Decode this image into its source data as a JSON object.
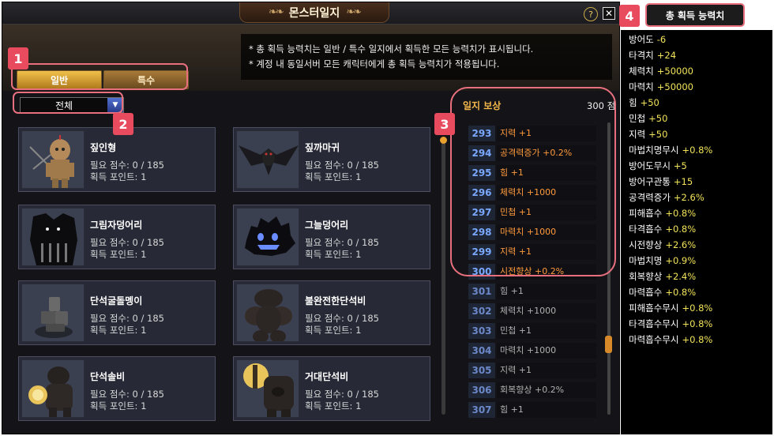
{
  "window": {
    "title": "몬스터일지",
    "help_label": "?",
    "close_label": "✕"
  },
  "notice": {
    "line1": "* 총 획득 능력치는 일반 / 특수 일지에서 획득한 모든 능력치가 표시됩니다.",
    "line2": "* 계정 내 동일서버 모든 캐릭터에게 총 획득 능력치가 적용됩니다."
  },
  "tabs": [
    {
      "label": "일반"
    },
    {
      "label": "특수"
    }
  ],
  "filter": {
    "selected": "전체"
  },
  "monsters": [
    {
      "name": "짚인형",
      "req": "필요 점수: 0 / 185",
      "pts": "획득 포인트: 1",
      "icon": "scarecrow-doll-icon"
    },
    {
      "name": "짚까마귀",
      "req": "필요 점수: 0 / 185",
      "pts": "획득 포인트: 1",
      "icon": "crow-icon"
    },
    {
      "name": "그림자덩어리",
      "req": "필요 점수: 0 / 185",
      "pts": "획득 포인트: 1",
      "icon": "shadow-monster-icon"
    },
    {
      "name": "그늘덩어리",
      "req": "필요 점수: 0 / 185",
      "pts": "획득 포인트: 1",
      "icon": "shade-blob-icon"
    },
    {
      "name": "단석굴돌멩이",
      "req": "필요 점수: 0 / 185",
      "pts": "획득 포인트: 1",
      "icon": "rock-pile-icon"
    },
    {
      "name": "불완전한단석비",
      "req": "필요 점수: 0 / 185",
      "pts": "획득 포인트: 1",
      "icon": "rock-golem-icon"
    },
    {
      "name": "단석솔비",
      "req": "필요 점수: 0 / 185",
      "pts": "획득 포인트: 1",
      "icon": "stone-soldier-icon"
    },
    {
      "name": "거대단석비",
      "req": "필요 점수: 0 / 185",
      "pts": "획득 포인트: 1",
      "icon": "giant-stone-icon"
    }
  ],
  "rewards": {
    "title": "일지 보상",
    "score": "300 점",
    "items": [
      {
        "num": "293",
        "effect": "지력 +1",
        "achieved": true
      },
      {
        "num": "294",
        "effect": "공격력증가 +0.2%",
        "achieved": true
      },
      {
        "num": "295",
        "effect": "힘 +1",
        "achieved": true
      },
      {
        "num": "296",
        "effect": "체력치 +1000",
        "achieved": true
      },
      {
        "num": "297",
        "effect": "민첩 +1",
        "achieved": true
      },
      {
        "num": "298",
        "effect": "마력치 +1000",
        "achieved": true
      },
      {
        "num": "299",
        "effect": "지력 +1",
        "achieved": true
      },
      {
        "num": "300",
        "effect": "시전향상 +0.2%",
        "achieved": true
      },
      {
        "num": "301",
        "effect": "힘 +1",
        "achieved": false
      },
      {
        "num": "302",
        "effect": "체력치 +1000",
        "achieved": false
      },
      {
        "num": "303",
        "effect": "민첩 +1",
        "achieved": false
      },
      {
        "num": "304",
        "effect": "마력치 +1000",
        "achieved": false
      },
      {
        "num": "305",
        "effect": "지력 +1",
        "achieved": false
      },
      {
        "num": "306",
        "effect": "회복향상 +0.2%",
        "achieved": false
      },
      {
        "num": "307",
        "effect": "힘 +1",
        "achieved": false
      }
    ]
  },
  "callouts": [
    "1",
    "2",
    "3",
    "4"
  ],
  "totals": {
    "title": "총 획득 능력치",
    "stats": [
      {
        "name": "방어도",
        "value": "-6"
      },
      {
        "name": "타격치",
        "value": "+24"
      },
      {
        "name": "체력치",
        "value": "+50000"
      },
      {
        "name": "마력치",
        "value": "+50000"
      },
      {
        "name": "힘",
        "value": "+50"
      },
      {
        "name": "민첩",
        "value": "+50"
      },
      {
        "name": "지력",
        "value": "+50"
      },
      {
        "name": "마법치명무시",
        "value": "+0.8%"
      },
      {
        "name": "방어도무시",
        "value": "+5"
      },
      {
        "name": "방어구관통",
        "value": "+15"
      },
      {
        "name": "공격력증가",
        "value": "+2.6%"
      },
      {
        "name": "피해흡수",
        "value": "+0.8%"
      },
      {
        "name": "타격흡수",
        "value": "+0.8%"
      },
      {
        "name": "시전향상",
        "value": "+2.6%"
      },
      {
        "name": "마법치명",
        "value": "+0.9%"
      },
      {
        "name": "회복향상",
        "value": "+2.4%"
      },
      {
        "name": "마력흡수",
        "value": "+0.8%"
      },
      {
        "name": "피해흡수무시",
        "value": "+0.8%"
      },
      {
        "name": "타격흡수무시",
        "value": "+0.8%"
      },
      {
        "name": "마력흡수무시",
        "value": "+0.8%"
      }
    ]
  },
  "colors": {
    "callout": "#e84a5e",
    "achieved_effect": "#ff9a3c",
    "reward_number": "#7aa8ff",
    "stat_value": "#f2e35a",
    "tab_active": "#f0c04a"
  }
}
